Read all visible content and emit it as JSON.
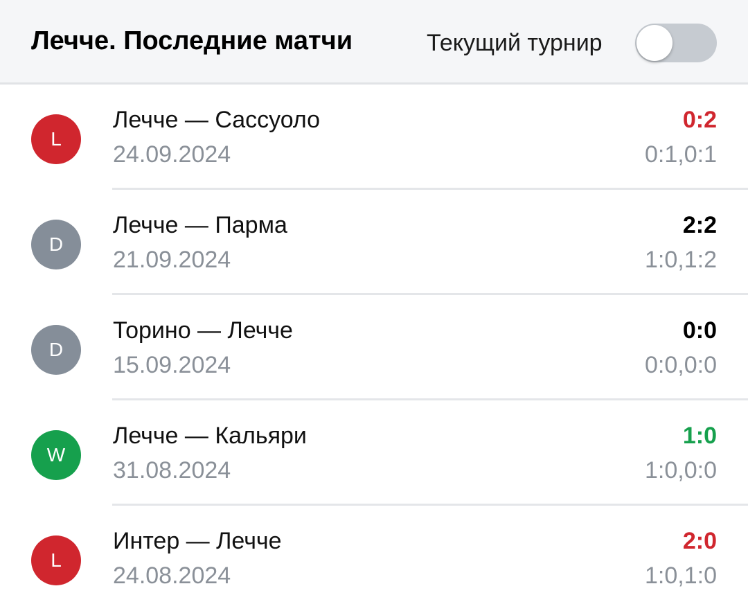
{
  "header": {
    "title": "Лечче. Последние матчи",
    "toggle_label": "Текущий турнир",
    "toggle_on": false
  },
  "colors": {
    "loss": "#d0262e",
    "draw": "#858e99",
    "win": "#16a04d",
    "neutral_score": "#000000"
  },
  "matches": [
    {
      "result": "L",
      "teams": "Лечче — Сассуоло",
      "date": "24.09.2024",
      "score": "0:2",
      "halves": "0:1,0:1"
    },
    {
      "result": "D",
      "teams": "Лечче — Парма",
      "date": "21.09.2024",
      "score": "2:2",
      "halves": "1:0,1:2"
    },
    {
      "result": "D",
      "teams": "Торино — Лечче",
      "date": "15.09.2024",
      "score": "0:0",
      "halves": "0:0,0:0"
    },
    {
      "result": "W",
      "teams": "Лечче — Кальяри",
      "date": "31.08.2024",
      "score": "1:0",
      "halves": "1:0,0:0"
    },
    {
      "result": "L",
      "teams": "Интер — Лечче",
      "date": "24.08.2024",
      "score": "2:0",
      "halves": "1:0,1:0"
    }
  ]
}
